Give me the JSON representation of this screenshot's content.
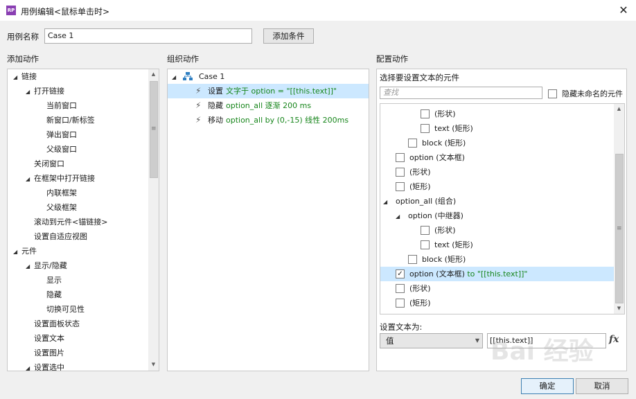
{
  "window": {
    "app_icon_text": "RP",
    "title": "用例编辑<鼠标单击时>",
    "close_glyph": "✕"
  },
  "case_name": {
    "label": "用例名称",
    "value": "Case 1",
    "add_condition_label": "添加条件"
  },
  "add_actions": {
    "title": "添加动作",
    "items": [
      {
        "label": "链接",
        "level": 0,
        "expanded": true
      },
      {
        "label": "打开链接",
        "level": 1,
        "expanded": true
      },
      {
        "label": "当前窗口",
        "level": 2
      },
      {
        "label": "新窗口/新标签",
        "level": 2
      },
      {
        "label": "弹出窗口",
        "level": 2
      },
      {
        "label": "父级窗口",
        "level": 2
      },
      {
        "label": "关闭窗口",
        "level": 1
      },
      {
        "label": "在框架中打开链接",
        "level": 1,
        "expanded": true
      },
      {
        "label": "内联框架",
        "level": 2
      },
      {
        "label": "父级框架",
        "level": 2
      },
      {
        "label": "滚动到元件<锚链接>",
        "level": 1
      },
      {
        "label": "设置自适应视图",
        "level": 1
      },
      {
        "label": "元件",
        "level": 0,
        "expanded": true
      },
      {
        "label": "显示/隐藏",
        "level": 1,
        "expanded": true
      },
      {
        "label": "显示",
        "level": 2
      },
      {
        "label": "隐藏",
        "level": 2
      },
      {
        "label": "切换可见性",
        "level": 2
      },
      {
        "label": "设置面板状态",
        "level": 1
      },
      {
        "label": "设置文本",
        "level": 1
      },
      {
        "label": "设置图片",
        "level": 1
      },
      {
        "label": "设置选中",
        "level": 1,
        "expanded": true
      }
    ]
  },
  "organize_actions": {
    "title": "组织动作",
    "case_label": "Case 1",
    "actions": [
      {
        "verb": "设置",
        "detail": "文字于 option = \"[[this.text]]\"",
        "selected": true
      },
      {
        "verb": "隐藏",
        "detail": "option_all 逐渐 200 ms",
        "selected": false
      },
      {
        "verb": "移动",
        "detail": "option_all by (0,-15) 线性 200ms",
        "selected": false
      }
    ]
  },
  "configure_actions": {
    "title": "配置动作",
    "subtitle": "选择要设置文本的元件",
    "search_placeholder": "查找",
    "hide_unnamed_label": "隐藏未命名的元件",
    "tree": [
      {
        "label": "(形状)",
        "level": 3,
        "checkbox": true,
        "checked": false
      },
      {
        "label": "text (矩形)",
        "level": 3,
        "checkbox": true,
        "checked": false
      },
      {
        "label": "block (矩形)",
        "level": 2,
        "checkbox": true,
        "checked": false
      },
      {
        "label": "option (文本框)",
        "level": 1,
        "checkbox": true,
        "checked": false
      },
      {
        "label": "(形状)",
        "level": 1,
        "checkbox": true,
        "checked": false
      },
      {
        "label": "(矩形)",
        "level": 1,
        "checkbox": true,
        "checked": false
      },
      {
        "label": "option_all (组合)",
        "level": 0,
        "checkbox": false,
        "expanded": true
      },
      {
        "label": "option (中继器)",
        "level": 1,
        "checkbox": false,
        "expanded": true
      },
      {
        "label": "(形状)",
        "level": 3,
        "checkbox": true,
        "checked": false
      },
      {
        "label": "text (矩形)",
        "level": 3,
        "checkbox": true,
        "checked": false
      },
      {
        "label": "block (矩形)",
        "level": 2,
        "checkbox": true,
        "checked": false
      },
      {
        "label": "option (文本框)",
        "suffix": " to \"[[this.text]]\"",
        "level": 1,
        "checkbox": true,
        "checked": true,
        "selected": true
      },
      {
        "label": "(形状)",
        "level": 1,
        "checkbox": true,
        "checked": false
      },
      {
        "label": "(矩形)",
        "level": 1,
        "checkbox": true,
        "checked": false
      }
    ],
    "set_text_label": "设置文本为:",
    "value_type": "值",
    "value": "[[this.text]]",
    "fx_label": "fx"
  },
  "footer": {
    "ok_label": "确定",
    "cancel_label": "取消"
  },
  "watermark": "Bai 经验",
  "colors": {
    "selection": "#cce8ff",
    "action_detail": "#16851a",
    "app_icon": "#8a3fb3"
  }
}
